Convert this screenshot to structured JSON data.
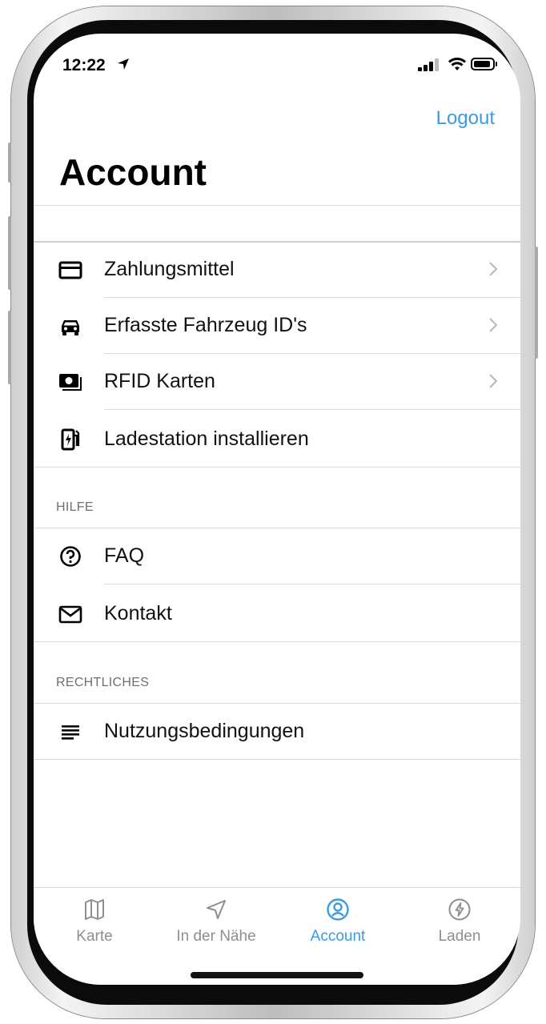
{
  "status": {
    "time": "12:22"
  },
  "header": {
    "logout_label": "Logout",
    "title": "Account"
  },
  "account_items": [
    {
      "label": "Zahlungsmittel",
      "icon": "credit-card-icon",
      "chevron": true
    },
    {
      "label": "Erfasste Fahrzeug ID's",
      "icon": "car-icon",
      "chevron": true
    },
    {
      "label": "RFID Karten",
      "icon": "rfid-card-icon",
      "chevron": true
    },
    {
      "label": "Ladestation installieren",
      "icon": "charging-station-icon",
      "chevron": false
    }
  ],
  "help": {
    "header": "HILFE",
    "items": [
      {
        "label": "FAQ",
        "icon": "question-circle-icon"
      },
      {
        "label": "Kontakt",
        "icon": "mail-icon"
      }
    ]
  },
  "legal": {
    "header": "RECHTLICHES",
    "items": [
      {
        "label": "Nutzungsbedingungen",
        "icon": "text-lines-icon"
      }
    ]
  },
  "tabbar": {
    "tabs": [
      {
        "label": "Karte",
        "icon": "map-icon",
        "active": false
      },
      {
        "label": "In der Nähe",
        "icon": "navigation-arrow-icon",
        "active": false
      },
      {
        "label": "Account",
        "icon": "user-circle-icon",
        "active": true
      },
      {
        "label": "Laden",
        "icon": "lightning-circle-icon",
        "active": false
      }
    ]
  },
  "colors": {
    "accent": "#3b9be0",
    "text": "#111111",
    "muted": "#8e8e8e",
    "separator": "#dcdcdc"
  }
}
